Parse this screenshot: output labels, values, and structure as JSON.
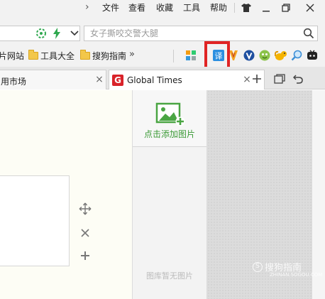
{
  "menu": {
    "items": [
      "文件",
      "查看",
      "收藏",
      "工具",
      "帮助"
    ]
  },
  "address": {
    "search_placeholder": "女子撕咬交警大腿"
  },
  "bookmarks": {
    "items": [
      "片网站",
      "工具大全",
      "搜狗指南"
    ],
    "more": "»"
  },
  "extensions": [
    "apps-grid-icon",
    "translate-icon",
    "bolt-icon",
    "v-icon",
    "face-icon",
    "squirrel-icon",
    "magnifier-icon",
    "tv-icon"
  ],
  "highlight_color": "#e02424",
  "tabs": [
    {
      "title": "用市场"
    },
    {
      "title": "Global Times",
      "badge": "G"
    }
  ],
  "gallery": {
    "add_label": "点击添加图片",
    "empty_label": "图库暂无图片"
  },
  "watermark": {
    "text": "搜狗指南",
    "sub": "ZHINAN.SOGOU.COM"
  }
}
